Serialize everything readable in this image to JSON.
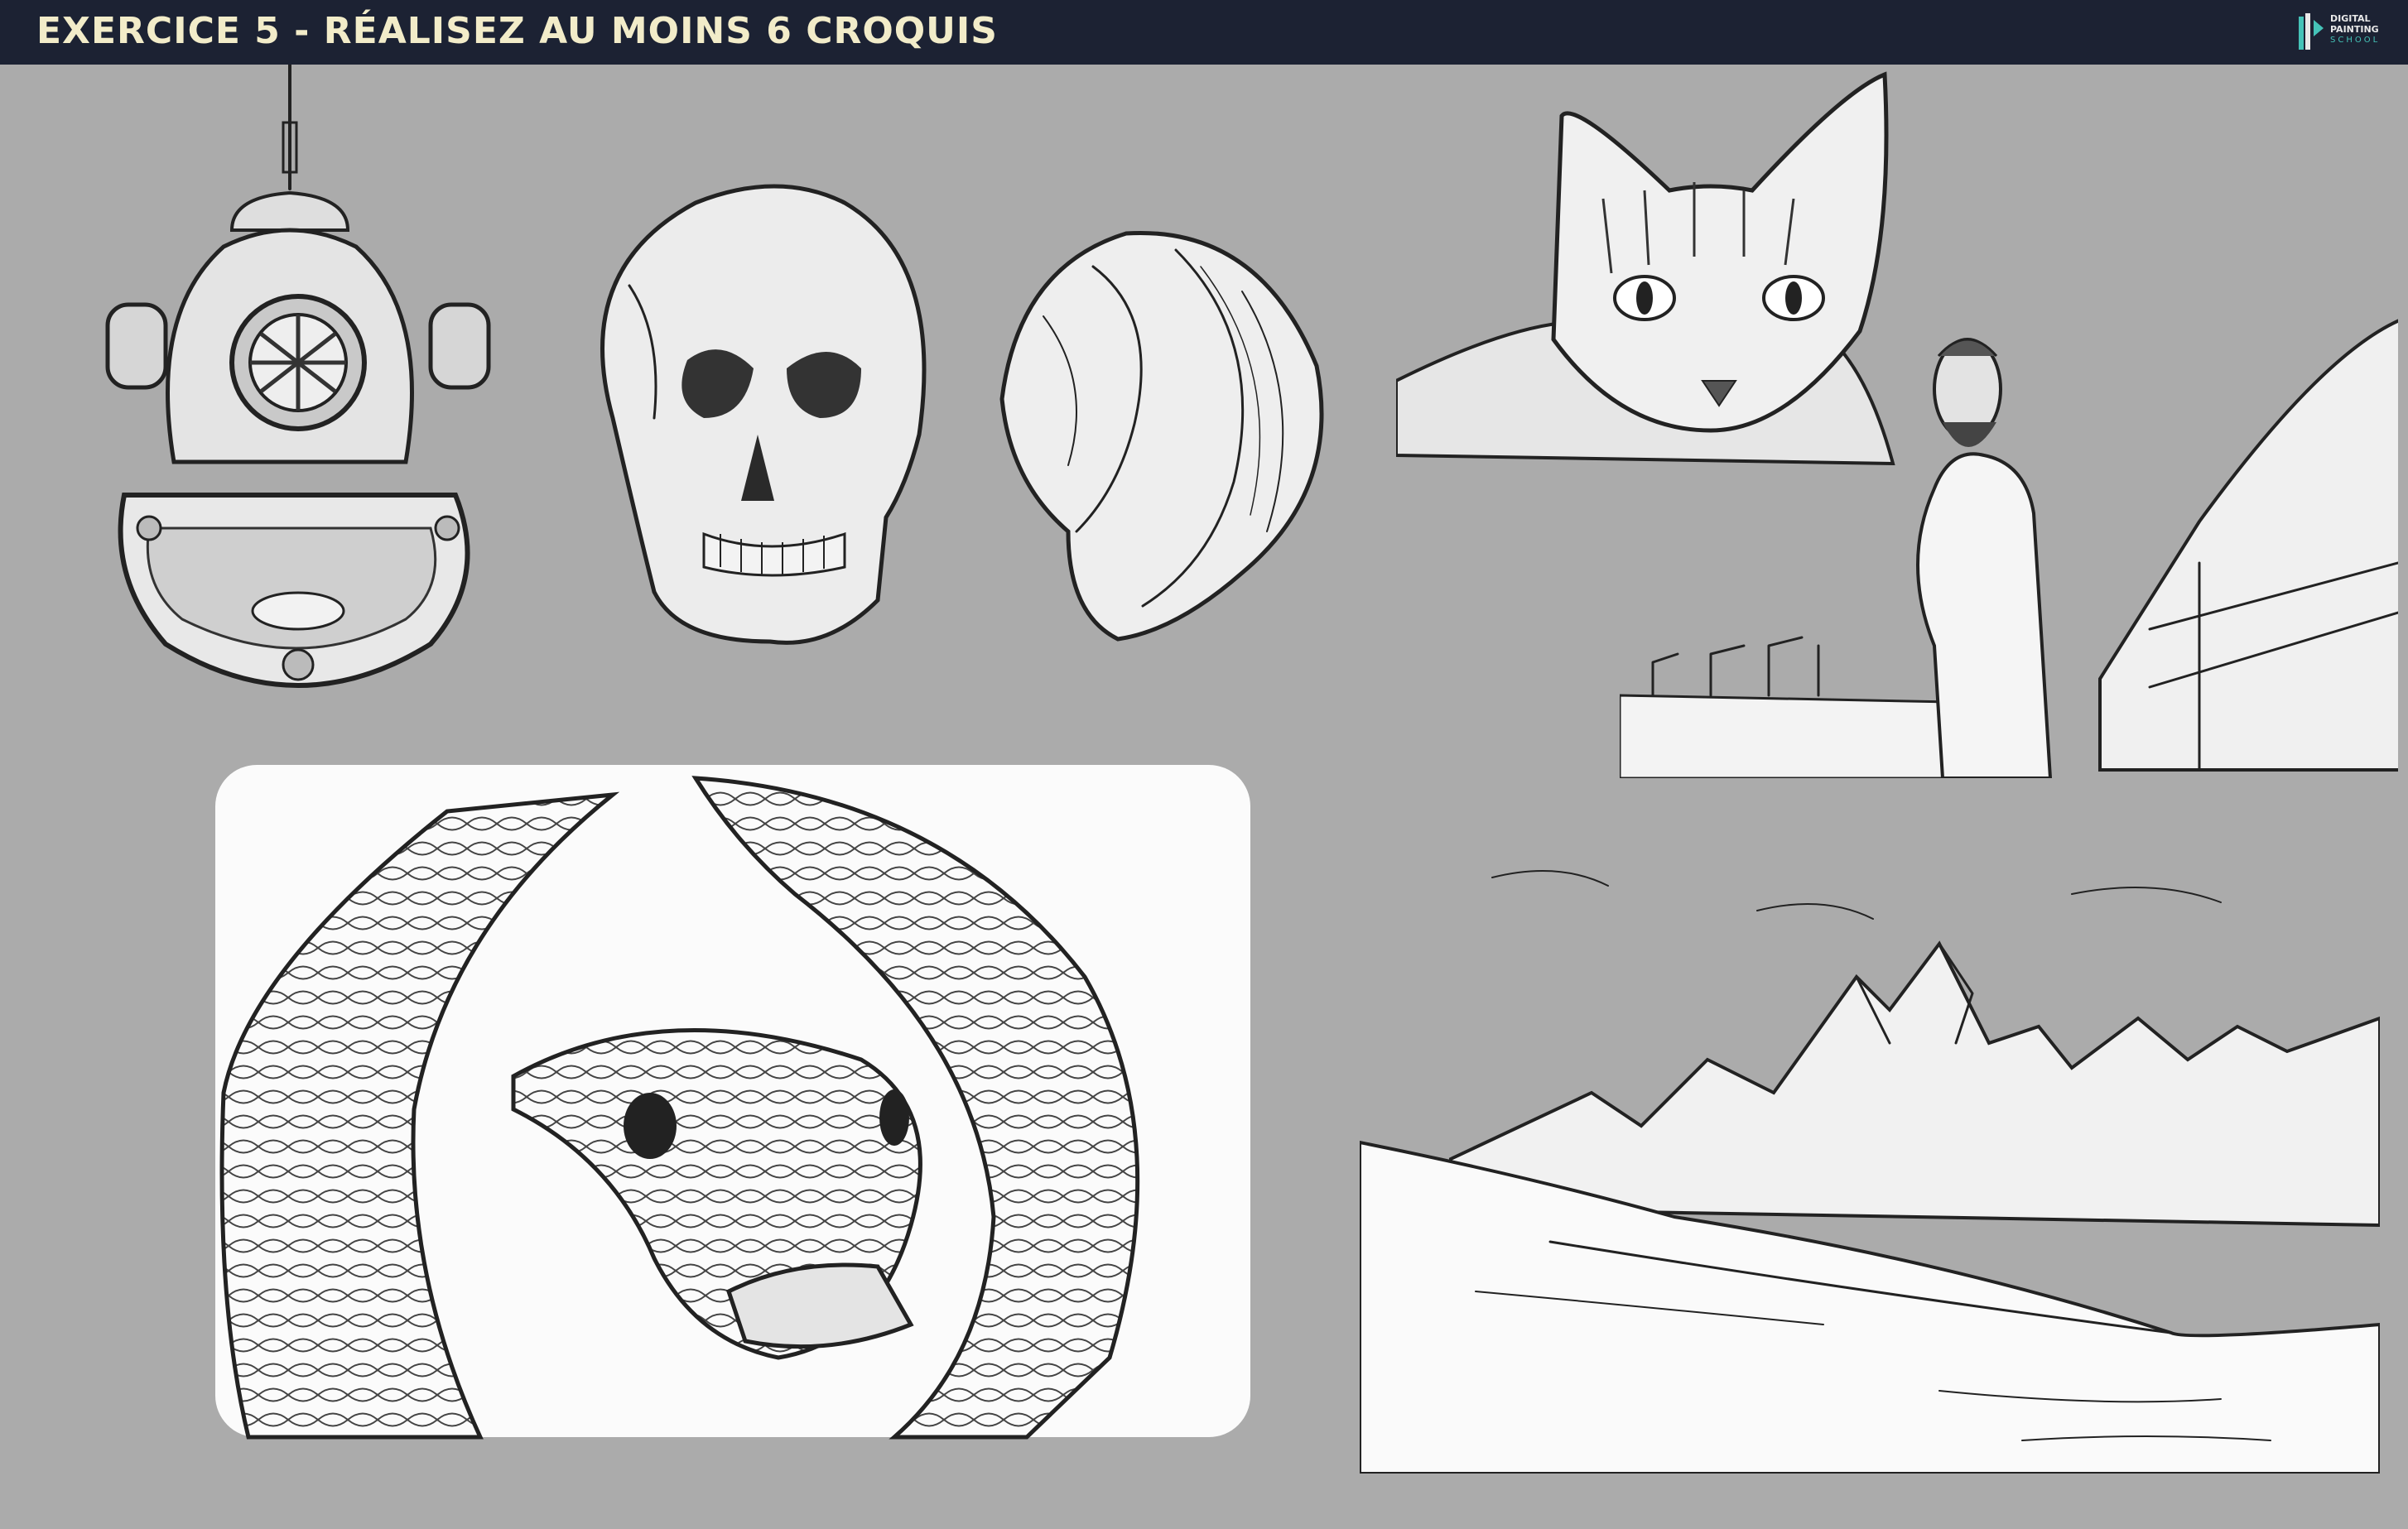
{
  "header": {
    "title": "EXERCICE 5 - RÉALISEZ AU MOINS 6 CROQUIS"
  },
  "logo": {
    "line1": "DIGITAL",
    "line2": "PAINTING",
    "line3": "SCHOOL"
  },
  "colors": {
    "header_bg": "#1c2233",
    "title": "#f2ecc9",
    "canvas_bg": "#ababab",
    "logo_accent": "#45c3b8"
  }
}
